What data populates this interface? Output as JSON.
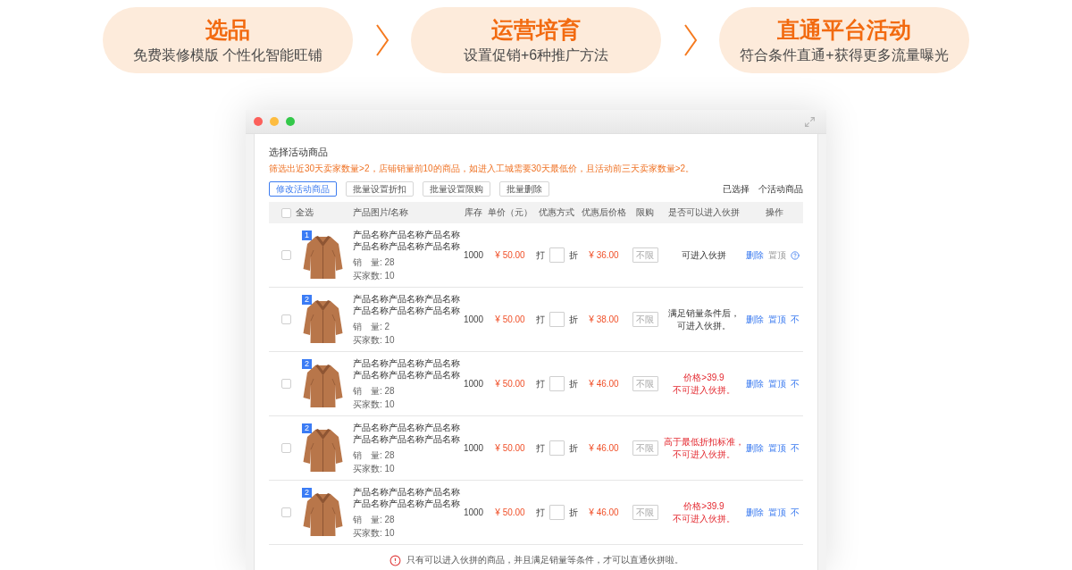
{
  "steps": [
    {
      "title": "选品",
      "subtitle": "免费装修模版 个性化智能旺铺"
    },
    {
      "title": "运营培育",
      "subtitle": "设置促销+6种推广方法"
    },
    {
      "title": "直通平台活动",
      "subtitle": "符合条件直通+获得更多流量曝光"
    }
  ],
  "panel": {
    "title": "选择活动商品",
    "note": "筛选出近30天卖家数量>2，店铺销量前10的商品，如进入工城需要30天最低价，且活动前三天卖家数量>2。",
    "buttons": [
      {
        "label": "修改活动商品",
        "primary": true
      },
      {
        "label": "批量设置折扣",
        "primary": false
      },
      {
        "label": "批量设置限购",
        "primary": false
      },
      {
        "label": "批量删除",
        "primary": false
      }
    ],
    "selection_summary": [
      "已选择",
      "个活动商品"
    ]
  },
  "table": {
    "select_all": {
      "label": "全选",
      "checked": false
    },
    "columns": [
      "产品图片/名称",
      "库存",
      "单价（元）",
      "优惠方式",
      "优惠后价格",
      "限购",
      "是否可以进入伙拼",
      "操作"
    ],
    "rows": [
      {
        "checked": false,
        "rank": "1",
        "name": "产品名称产品名称产品名称产品名称产品名称产品名称",
        "sales": "销　量: 28",
        "buyers": "买家数: 10",
        "stock": "1000",
        "price": "¥ 50.00",
        "discount_prefix": "打",
        "discount_suffix": "折",
        "final_price": "¥ 36.00",
        "limit_placeholder": "不限",
        "eligible": true,
        "eligibility": [
          "可进入伙拼"
        ],
        "actions": [
          {
            "kind": "link",
            "label": "删除",
            "disabled": false
          },
          {
            "kind": "link",
            "label": "置顶",
            "disabled": true
          },
          {
            "kind": "help"
          }
        ]
      },
      {
        "checked": false,
        "rank": "2",
        "name": "产品名称产品名称产品名称产品名称产品名称产品名称",
        "sales": "销　量: 2",
        "buyers": "买家数: 10",
        "stock": "1000",
        "price": "¥ 50.00",
        "discount_prefix": "打",
        "discount_suffix": "折",
        "final_price": "¥ 38.00",
        "limit_placeholder": "不限",
        "eligible": true,
        "eligibility": [
          "满足销量条件后，",
          "可进入伙拼。"
        ],
        "actions": [
          {
            "kind": "link",
            "label": "删除",
            "disabled": false
          },
          {
            "kind": "link",
            "label": "置顶",
            "disabled": false
          },
          {
            "kind": "link",
            "label": "不",
            "disabled": false
          }
        ]
      },
      {
        "checked": false,
        "rank": "2",
        "name": "产品名称产品名称产品名称产品名称产品名称产品名称",
        "sales": "销　量: 28",
        "buyers": "买家数: 10",
        "stock": "1000",
        "price": "¥ 50.00",
        "discount_prefix": "打",
        "discount_suffix": "折",
        "final_price": "¥ 46.00",
        "limit_placeholder": "不限",
        "eligible": false,
        "eligibility": [
          "价格>39.9",
          "不可进入伙拼。"
        ],
        "actions": [
          {
            "kind": "link",
            "label": "删除",
            "disabled": false
          },
          {
            "kind": "link",
            "label": "置顶",
            "disabled": false
          },
          {
            "kind": "link",
            "label": "不",
            "disabled": false
          }
        ]
      },
      {
        "checked": false,
        "rank": "2",
        "name": "产品名称产品名称产品名称产品名称产品名称产品名称",
        "sales": "销　量: 28",
        "buyers": "买家数: 10",
        "stock": "1000",
        "price": "¥ 50.00",
        "discount_prefix": "打",
        "discount_suffix": "折",
        "final_price": "¥ 46.00",
        "limit_placeholder": "不限",
        "eligible": false,
        "eligibility": [
          "高于最低折扣标准，",
          "不可进入伙拼。"
        ],
        "actions": [
          {
            "kind": "link",
            "label": "删除",
            "disabled": false
          },
          {
            "kind": "link",
            "label": "置顶",
            "disabled": false
          },
          {
            "kind": "link",
            "label": "不",
            "disabled": false
          }
        ]
      },
      {
        "checked": false,
        "rank": "2",
        "name": "产品名称产品名称产品名称产品名称产品名称产品名称",
        "sales": "销　量: 28",
        "buyers": "买家数: 10",
        "stock": "1000",
        "price": "¥ 50.00",
        "discount_prefix": "打",
        "discount_suffix": "折",
        "final_price": "¥ 46.00",
        "limit_placeholder": "不限",
        "eligible": false,
        "eligibility": [
          "价格>39.9",
          "不可进入伙拼。"
        ],
        "actions": [
          {
            "kind": "link",
            "label": "删除",
            "disabled": false
          },
          {
            "kind": "link",
            "label": "置顶",
            "disabled": false
          },
          {
            "kind": "link",
            "label": "不",
            "disabled": false
          }
        ]
      }
    ]
  },
  "footer_note": "只有可以进入伙拼的商品，并且满足销量等条件，才可以直通伙拼啦。"
}
